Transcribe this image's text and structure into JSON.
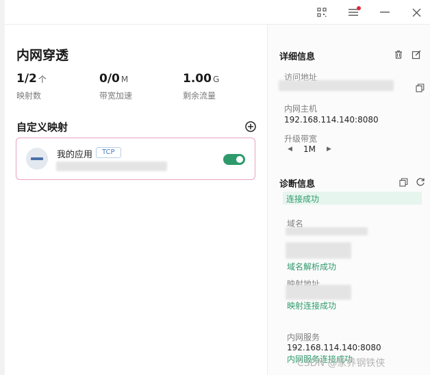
{
  "titlebar": {
    "icons": [
      "qrcode-icon",
      "menu-icon",
      "minimize-icon",
      "close-icon"
    ],
    "notification_color": "#e0263d"
  },
  "left": {
    "title": "内网穿透",
    "stats": [
      {
        "value": "1/2",
        "unit": "个",
        "label": "映射数"
      },
      {
        "value": "0/0",
        "unit": "M",
        "label": "带宽加速"
      },
      {
        "value": "1.00",
        "unit": "G",
        "label": "剩余流量"
      }
    ],
    "section_title": "自定义映射",
    "mapping": {
      "name": "我的应用",
      "protocol": "TCP",
      "enabled": true,
      "accent": "#2e9a6b",
      "border": "#e9a2c1"
    }
  },
  "right": {
    "details_title": "详细信息",
    "access_address_label": "访问地址",
    "intranet_host_label": "内网主机",
    "intranet_host_value": "192.168.114.140:8080",
    "bandwidth_label": "升级带宽",
    "bandwidth_value": "1M",
    "diag_title": "诊断信息",
    "diag_status": "连接成功",
    "domain_label": "域名",
    "domain_ok": "域名解析成功",
    "mapping_addr_label": "映射地址",
    "mapping_ok": "映射连接成功",
    "intranet_service_label": "内网服务",
    "intranet_service_value": "192.168.114.140:8080",
    "intranet_service_ok": "内网服务连接成功"
  },
  "watermark": "CSDN @家养钢铁侠"
}
